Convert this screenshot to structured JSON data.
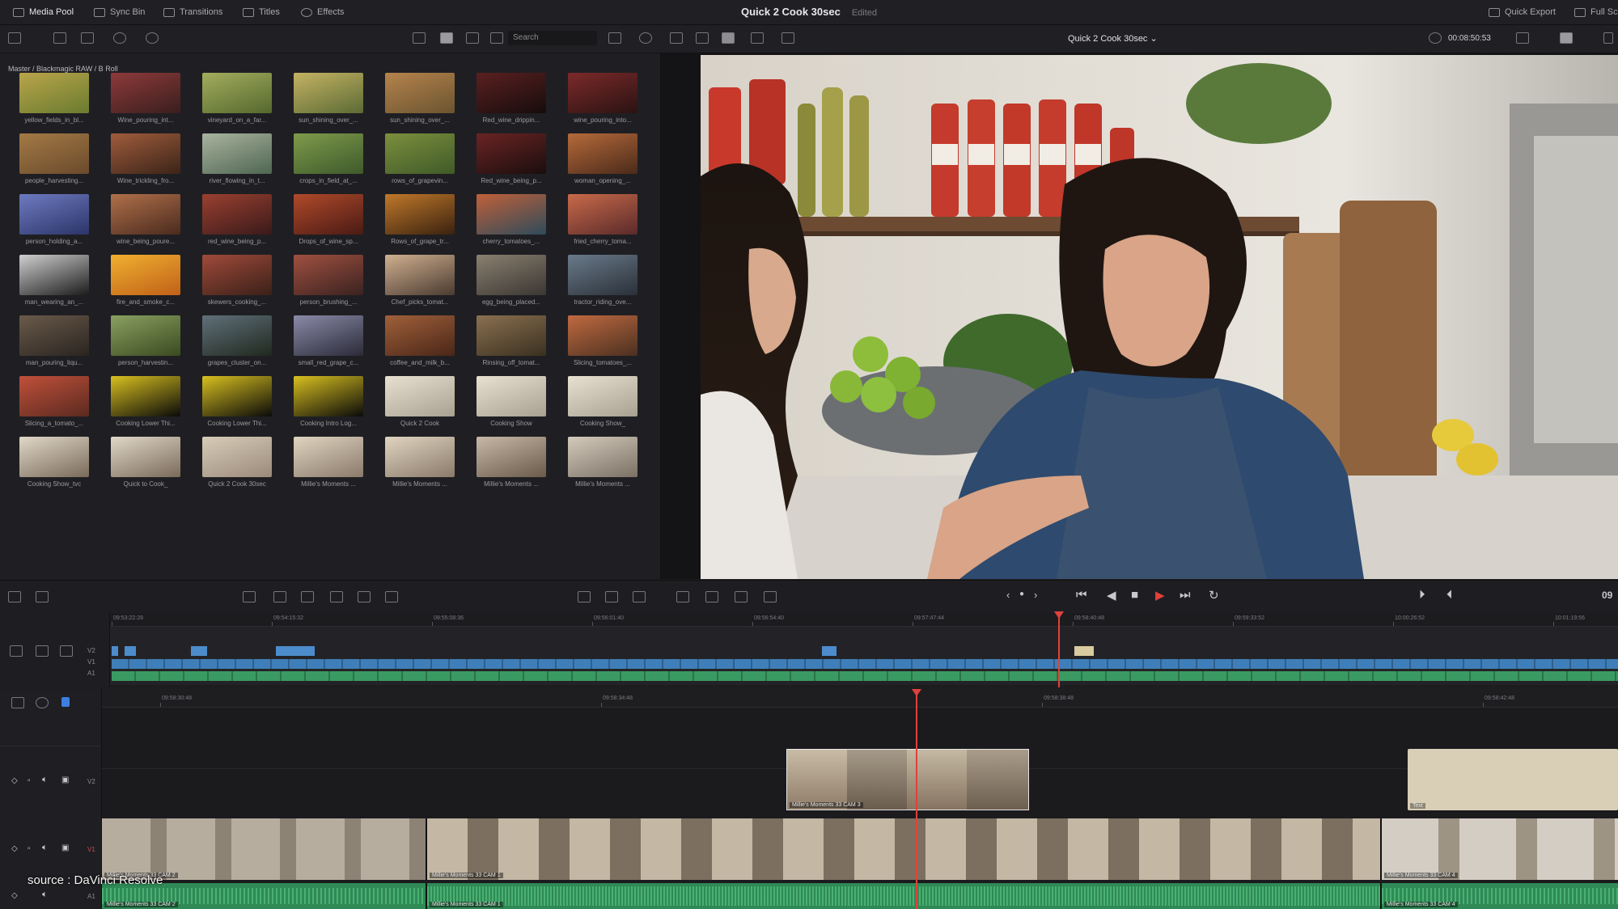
{
  "top_bar": {
    "tabs": [
      {
        "label": "Media Pool",
        "icon": "media-pool-icon"
      },
      {
        "label": "Sync Bin",
        "icon": "sync-bin-icon"
      },
      {
        "label": "Transitions",
        "icon": "transitions-icon"
      },
      {
        "label": "Titles",
        "icon": "titles-icon"
      },
      {
        "label": "Effects",
        "icon": "effects-icon"
      }
    ],
    "project_title": "Quick 2 Cook 30sec",
    "project_status": "Edited",
    "right_items": [
      {
        "label": "Quick Export",
        "icon": "export-icon"
      },
      {
        "label": "Full Sc",
        "icon": "fullscreen-icon"
      }
    ]
  },
  "toolbar": {
    "search_placeholder": "Search"
  },
  "media_pool": {
    "breadcrumb": "Master / Blackmagic RAW / B Roll",
    "clips": [
      "yellow_fields_in_bl...",
      "Wine_pouring_int...",
      "vineyard_on_a_far...",
      "sun_shining_over_...",
      "sun_shining_over_...",
      "Red_wine_drippin...",
      "wine_pouring_into...",
      "people_harvesting...",
      "Wine_trickling_fro...",
      "river_flowing_in_t...",
      "crops_in_field_at_...",
      "rows_of_grapevin...",
      "Red_wine_being_p...",
      "woman_opening_...",
      "person_holding_a...",
      "wine_being_poure...",
      "red_wine_being_p...",
      "Drops_of_wine_sp...",
      "Rows_of_grape_tr...",
      "cherry_tomatoes_...",
      "fried_cherry_toma...",
      "man_wearing_an_...",
      "fire_and_smoke_c...",
      "skewers_cooking_...",
      "person_brushing_...",
      "Chef_picks_tomat...",
      "egg_being_placed...",
      "tractor_riding_ove...",
      "man_pouring_liqu...",
      "person_harvestin...",
      "grapes_cluster_on...",
      "small_red_grape_c...",
      "coffee_and_milk_b...",
      "Rinsing_off_tomat...",
      "Slicing_tomatoes_...",
      "Slicing_a_tomato_...",
      "Cooking Lower Thi...",
      "Cooking Lower Thi...",
      "Cooking Intro Log...",
      "Quick 2 Cook",
      "Cooking Show",
      "Cooking Show_",
      "Cooking Show_tvc",
      "Quick to Cook_",
      "Quick 2 Cook 30sec",
      "Millie's Moments ...",
      "Millie's Moments ...",
      "Millie's Moments ...",
      "Millie's Moments ..."
    ]
  },
  "viewer": {
    "title": "Quick 2 Cook 30sec",
    "timecode": "00:08:50:53"
  },
  "transport": {
    "timecode_partial": "09"
  },
  "upper_timeline": {
    "ruler_labels": [
      "09:53:22:28",
      "09:54:15:32",
      "09:55:08:36",
      "09:56:01:40",
      "09:56:54:40",
      "09:57:47:44",
      "09:58:40:48",
      "09:59:33:52",
      "10:00:26:52",
      "10:01:19:56"
    ],
    "track_labels": [
      "V2",
      "V1",
      "A1"
    ]
  },
  "lower_timeline": {
    "ruler_labels": [
      "09:58:30:48",
      "09:58:34:48",
      "09:58:38:48",
      "09:58:42:48"
    ],
    "track_labels": [
      "V2",
      "V1",
      "A1"
    ],
    "clip_names": {
      "v2_clip": "Millie's Moments 33 CAM 3",
      "v2_title": "Text",
      "v1_a": "Millie's Moments 33 CAM 2",
      "v1_b": "Millie's Moments 33 CAM 1",
      "v1_c": "Millie's Moments 33 CAM 4",
      "a1_a": "Millie's Moments 33 CAM 2",
      "a1_b": "Millie's Moments 33 CAM 1",
      "a1_c": "Millie's Moments 33 CAM 4"
    }
  },
  "source_credit": "source : DaVinci Resolve",
  "colors": {
    "accent_playhead": "#e0413b",
    "video_clip": "#3f7fb9",
    "audio_clip": "#3a9a62"
  }
}
